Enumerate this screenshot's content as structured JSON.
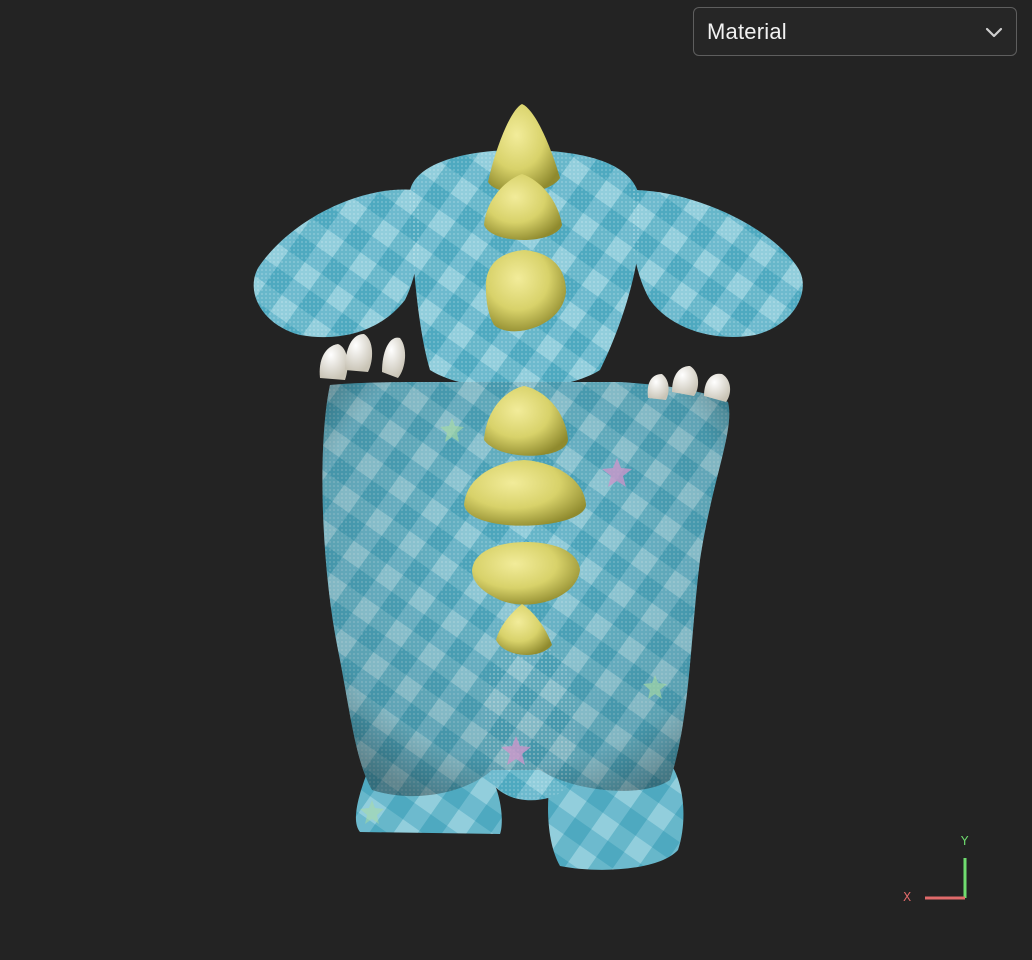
{
  "viewer": {
    "background": "#232323",
    "object": "plush-dinosaur-back-view",
    "render_mode": {
      "selected": "Material",
      "icon": "chevron-down-icon"
    },
    "axis_gizmo": {
      "x_label": "X",
      "y_label": "Y",
      "x_color": "#e06a6a",
      "y_color": "#6fdc6f"
    },
    "colors": {
      "body": "#5fb3c7",
      "body_shade": "#3f8fa6",
      "plaid_light": "#a8d9e3",
      "spikes": "#d8d26a",
      "spike_shade": "#9c9736",
      "claws": "#e8e4d8",
      "star_pink": "#c996c9",
      "star_green": "#a9dca0"
    }
  }
}
